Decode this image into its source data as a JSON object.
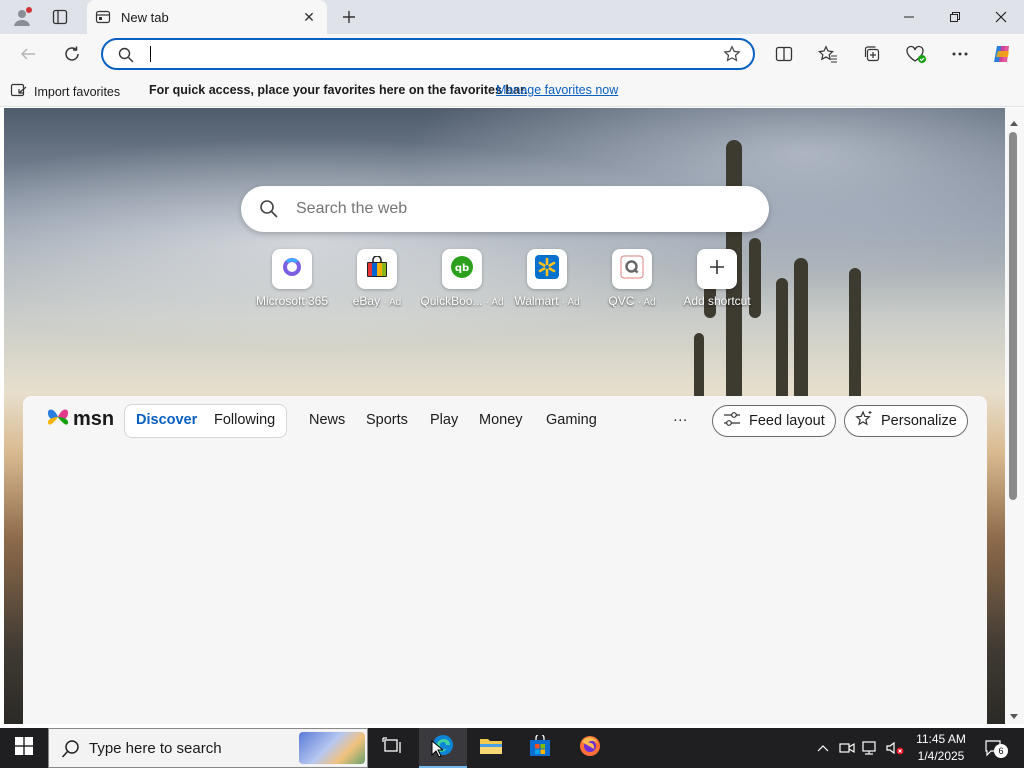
{
  "browser": {
    "tab_title": "New tab",
    "address_value": "",
    "address_placeholder": "",
    "favorites_bar": {
      "import_label": "Import favorites",
      "message": "For quick access, place your favorites here on the favorites bar.",
      "manage_link": "Manage favorites now"
    }
  },
  "newtab": {
    "search_placeholder": "Search the web",
    "shortcuts": [
      {
        "label": "Microsoft 365",
        "ad": ""
      },
      {
        "label": "eBay",
        "ad": "· Ad"
      },
      {
        "label": "QuickBoo...",
        "ad": "· Ad"
      },
      {
        "label": "Walmart",
        "ad": "· Ad"
      },
      {
        "label": "QVC",
        "ad": "· Ad"
      },
      {
        "label": "Add shortcut",
        "ad": ""
      }
    ]
  },
  "msn": {
    "logo_text": "msn",
    "tabs": [
      "Discover",
      "Following"
    ],
    "nav": [
      "News",
      "Sports",
      "Play",
      "Money",
      "Gaming"
    ],
    "more": "···",
    "feed_layout": "Feed layout",
    "personalize": "Personalize"
  },
  "taskbar": {
    "search_placeholder": "Type here to search",
    "time": "11:45 AM",
    "date": "1/4/2025",
    "notifications": "6"
  },
  "colors": {
    "accent": "#0a5fc2",
    "taskbar": "#1f1f22"
  }
}
